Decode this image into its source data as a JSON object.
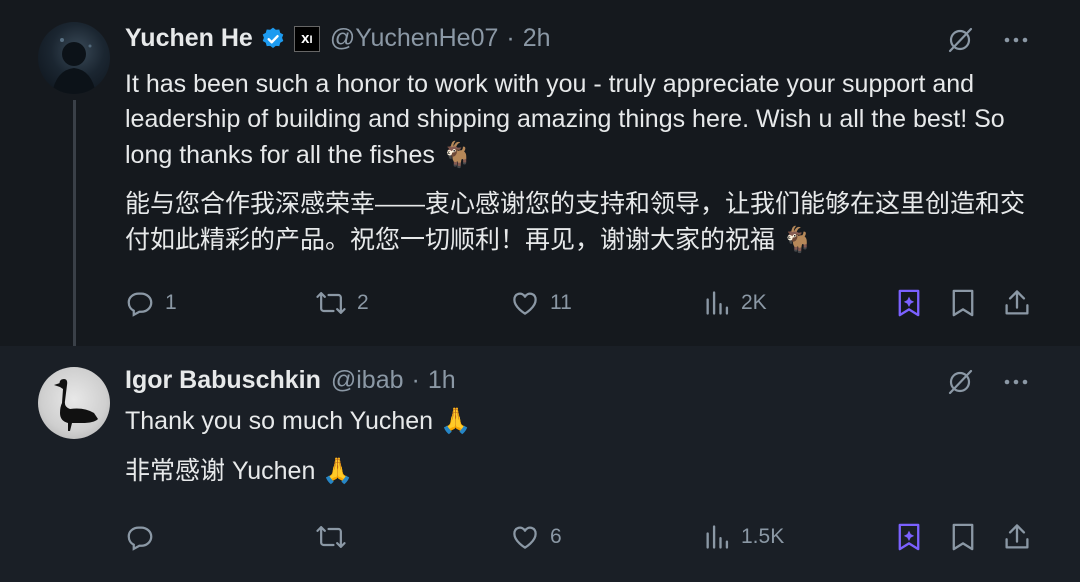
{
  "tweets": [
    {
      "author": {
        "name": "Yuchen He",
        "handle": "@YuchenHe07",
        "time": "2h",
        "verified": true,
        "affiliation_badge": "x.ai"
      },
      "text_en": "It has been such a honor to work with you - truly appreciate your support and leadership of building and shipping amazing things here. Wish u all the best! So long thanks for all the fishes",
      "text_zh": "能与您合作我深感荣幸——衷心感谢您的支持和领导，让我们能够在这里创造和交付如此精彩的产品。祝您一切顺利！再见，谢谢大家的祝福",
      "emoji": "🐐",
      "stats": {
        "replies": "1",
        "reposts": "2",
        "likes": "11",
        "views": "2K"
      }
    },
    {
      "author": {
        "name": "Igor Babuschkin",
        "handle": "@ibab",
        "time": "1h"
      },
      "text_en": "Thank you so much Yuchen",
      "text_zh": "非常感谢 Yuchen",
      "emoji": "🙏",
      "stats": {
        "replies": "",
        "reposts": "",
        "likes": "6",
        "views": "1.5K"
      }
    }
  ],
  "colors": {
    "background": "#15191e",
    "reply_background": "#1a1f26",
    "text": "#e7e9ea",
    "muted": "#8b98a5",
    "verified": "#1d9bf0",
    "grok_accent": "#7b61ff"
  },
  "icons": [
    "verified-badge-icon",
    "grok-icon",
    "more-icon",
    "reply-icon",
    "repost-icon",
    "like-icon",
    "views-icon",
    "grok-analyze-icon",
    "bookmark-icon",
    "share-icon"
  ]
}
